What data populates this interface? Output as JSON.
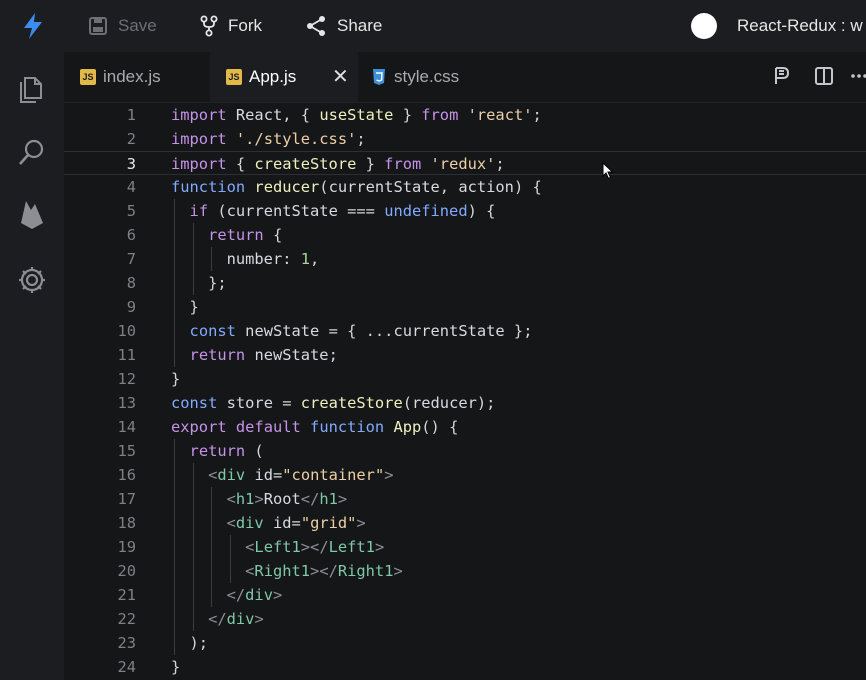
{
  "toolbar": {
    "save_label": "Save",
    "fork_label": "Fork",
    "share_label": "Share",
    "sandbox_title": "React-Redux : w"
  },
  "tabs": [
    {
      "label": "index.js",
      "type": "js"
    },
    {
      "label": "App.js",
      "type": "js"
    },
    {
      "label": "style.css",
      "type": "css"
    }
  ],
  "editor": {
    "active_line": 3,
    "line_numbers": [
      "1",
      "2",
      "3",
      "4",
      "5",
      "6",
      "7",
      "8",
      "9",
      "10",
      "11",
      "12",
      "13",
      "14",
      "15",
      "16",
      "17",
      "18",
      "19",
      "20",
      "21",
      "22",
      "23",
      "24"
    ],
    "lines": [
      "import React, { useState } from 'react';",
      "import './style.css';",
      "import { createStore } from 'redux';",
      "function reducer(currentState, action) {",
      "  if (currentState === undefined) {",
      "    return {",
      "      number: 1,",
      "    };",
      "  }",
      "  const newState = { ...currentState };",
      "  return newState;",
      "}",
      "const store = createStore(reducer);",
      "export default function App() {",
      "  return (",
      "    <div id=\"container\">",
      "      <h1>Root</h1>",
      "      <div id=\"grid\">",
      "        <Left1></Left1>",
      "        <Right1></Right1>",
      "      </div>",
      "    </div>",
      "  );",
      "}"
    ]
  },
  "colors": {
    "keyword": "#c792ea",
    "keyword_blue": "#82aaff",
    "function": "#eff0c0",
    "string": "#eccfa6",
    "number": "#a7d79b",
    "tag": "#7fc8a8",
    "logo": "#3b8df0"
  }
}
